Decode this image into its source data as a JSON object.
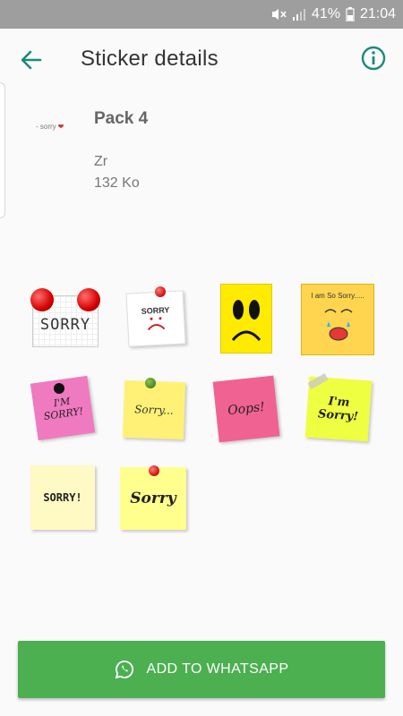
{
  "status_bar": {
    "battery": "41%",
    "time": "21:04"
  },
  "header": {
    "title": "Sticker details"
  },
  "pack": {
    "tray_text": "- sorry",
    "name": "Pack 4",
    "author": "Zr",
    "size": "132 Ko"
  },
  "stickers": [
    {
      "text": "SORRY"
    },
    {
      "text": "SORRY"
    },
    {
      "text": ""
    },
    {
      "text": "I am So Sorry....."
    },
    {
      "text": "I'M SORRY!"
    },
    {
      "text": "Sorry..."
    },
    {
      "text": "Oops!"
    },
    {
      "text": "I'm Sorry!"
    },
    {
      "text": "SORRY!"
    },
    {
      "text": "Sorry"
    }
  ],
  "action": {
    "label": "ADD TO WHATSAPP"
  },
  "colors": {
    "accent": "#1b8a7a",
    "button": "#4caf50",
    "status_bar": "#9e9e9e"
  },
  "icons": [
    "mute-icon",
    "signal-icon",
    "battery-icon",
    "back-arrow-icon",
    "info-icon",
    "whatsapp-icon"
  ]
}
